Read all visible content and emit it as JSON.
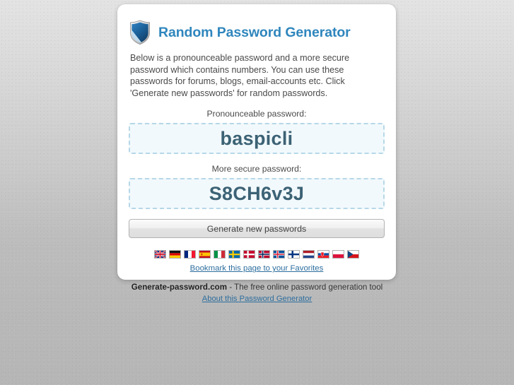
{
  "header": {
    "icon": "shield-icon",
    "title": "Random Password Generator",
    "title_color": "#2f86bd"
  },
  "intro": "Below is a pronounceable password and a more secure password which contains numbers. You can use these passwords for forums, blogs, email-accounts etc. Click 'Generate new passwords' for random passwords.",
  "passwords": [
    {
      "label": "Pronounceable password:",
      "value": "baspicli"
    },
    {
      "label": "More secure password:",
      "value": "S8CH6v3J"
    }
  ],
  "generate_button_label": "Generate new passwords",
  "flags": [
    {
      "name": "flag-united-kingdom",
      "country": "United Kingdom"
    },
    {
      "name": "flag-germany",
      "country": "Germany"
    },
    {
      "name": "flag-france",
      "country": "France"
    },
    {
      "name": "flag-spain",
      "country": "Spain"
    },
    {
      "name": "flag-italy",
      "country": "Italy"
    },
    {
      "name": "flag-sweden",
      "country": "Sweden"
    },
    {
      "name": "flag-denmark",
      "country": "Denmark"
    },
    {
      "name": "flag-norway",
      "country": "Norway"
    },
    {
      "name": "flag-iceland",
      "country": "Iceland"
    },
    {
      "name": "flag-finland",
      "country": "Finland"
    },
    {
      "name": "flag-netherlands",
      "country": "Netherlands"
    },
    {
      "name": "flag-slovakia",
      "country": "Slovakia"
    },
    {
      "name": "flag-poland",
      "country": "Poland"
    },
    {
      "name": "flag-czech-republic",
      "country": "Czech Republic"
    }
  ],
  "bookmark_link": "Bookmark this page to your Favorites",
  "footer": {
    "brand": "Generate-password.com",
    "tagline": " - The free online password generation tool",
    "about_link": "About this Password Generator"
  },
  "colors": {
    "accent_blue": "#2f86bd",
    "link_blue": "#2d6e9e",
    "password_text": "#3c6275",
    "password_box_bg": "#f2f9fc",
    "password_box_border": "#b6d8e8",
    "page_bg_top": "#e3e3e3",
    "page_bg_bottom": "#b6b6b6"
  }
}
